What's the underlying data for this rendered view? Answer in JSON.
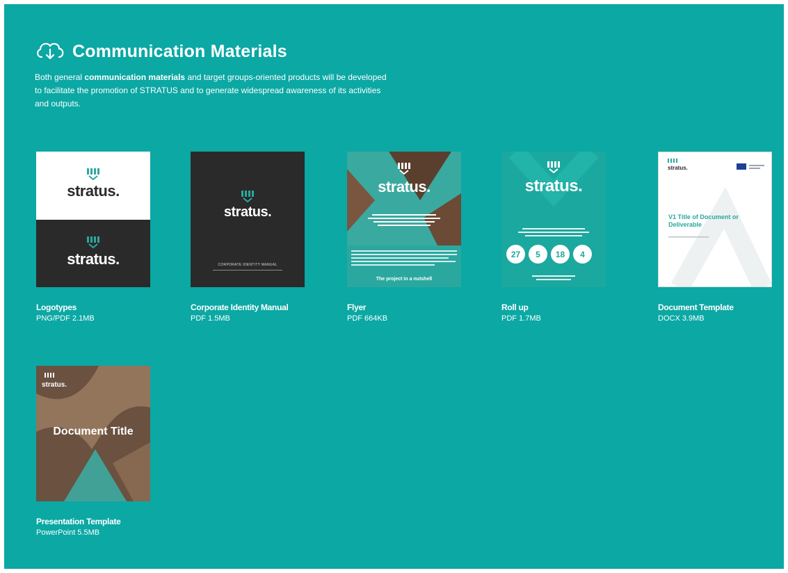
{
  "section": {
    "title": "Communication Materials",
    "icon": "cloud-download-icon",
    "description": {
      "before": "Both general ",
      "bold": "communication materials",
      "after": " and target groups-oriented products will be developed to facilitate the promotion of STRATUS and to generate widespread awareness of its activities and outputs."
    }
  },
  "items": [
    {
      "name": "Logotypes",
      "meta": "PNG/PDF 2.1MB",
      "thumb": {
        "logo_top": "stratus.",
        "logo_bottom": "stratus."
      }
    },
    {
      "name": "Corporate Identity Manual",
      "meta": "PDF 1.5MB",
      "thumb": {
        "logo": "stratus.",
        "caption": "CORPORATE IDENTITY MANUAL"
      }
    },
    {
      "name": "Flyer",
      "meta": "PDF 664KB",
      "thumb": {
        "logo": "stratus.",
        "footer": "The project in a nutshell"
      }
    },
    {
      "name": "Roll up",
      "meta": "PDF 1.7MB",
      "thumb": {
        "logo": "stratus.",
        "stats": [
          "27",
          "5",
          "18",
          "4"
        ]
      }
    },
    {
      "name": "Document Template",
      "meta": "DOCX 3.9MB",
      "thumb": {
        "logo": "stratus.",
        "doc_title": "V1 Title of Document or Deliverable"
      }
    },
    {
      "name": "Presentation Template",
      "meta": "PowerPoint 5.5MB",
      "thumb": {
        "logo": "stratus.",
        "slide_title": "Document Title"
      }
    }
  ],
  "colors": {
    "background": "#0ba8a4",
    "dark": "#2b2a2a",
    "teal": "#2aa89f",
    "white": "#ffffff"
  }
}
